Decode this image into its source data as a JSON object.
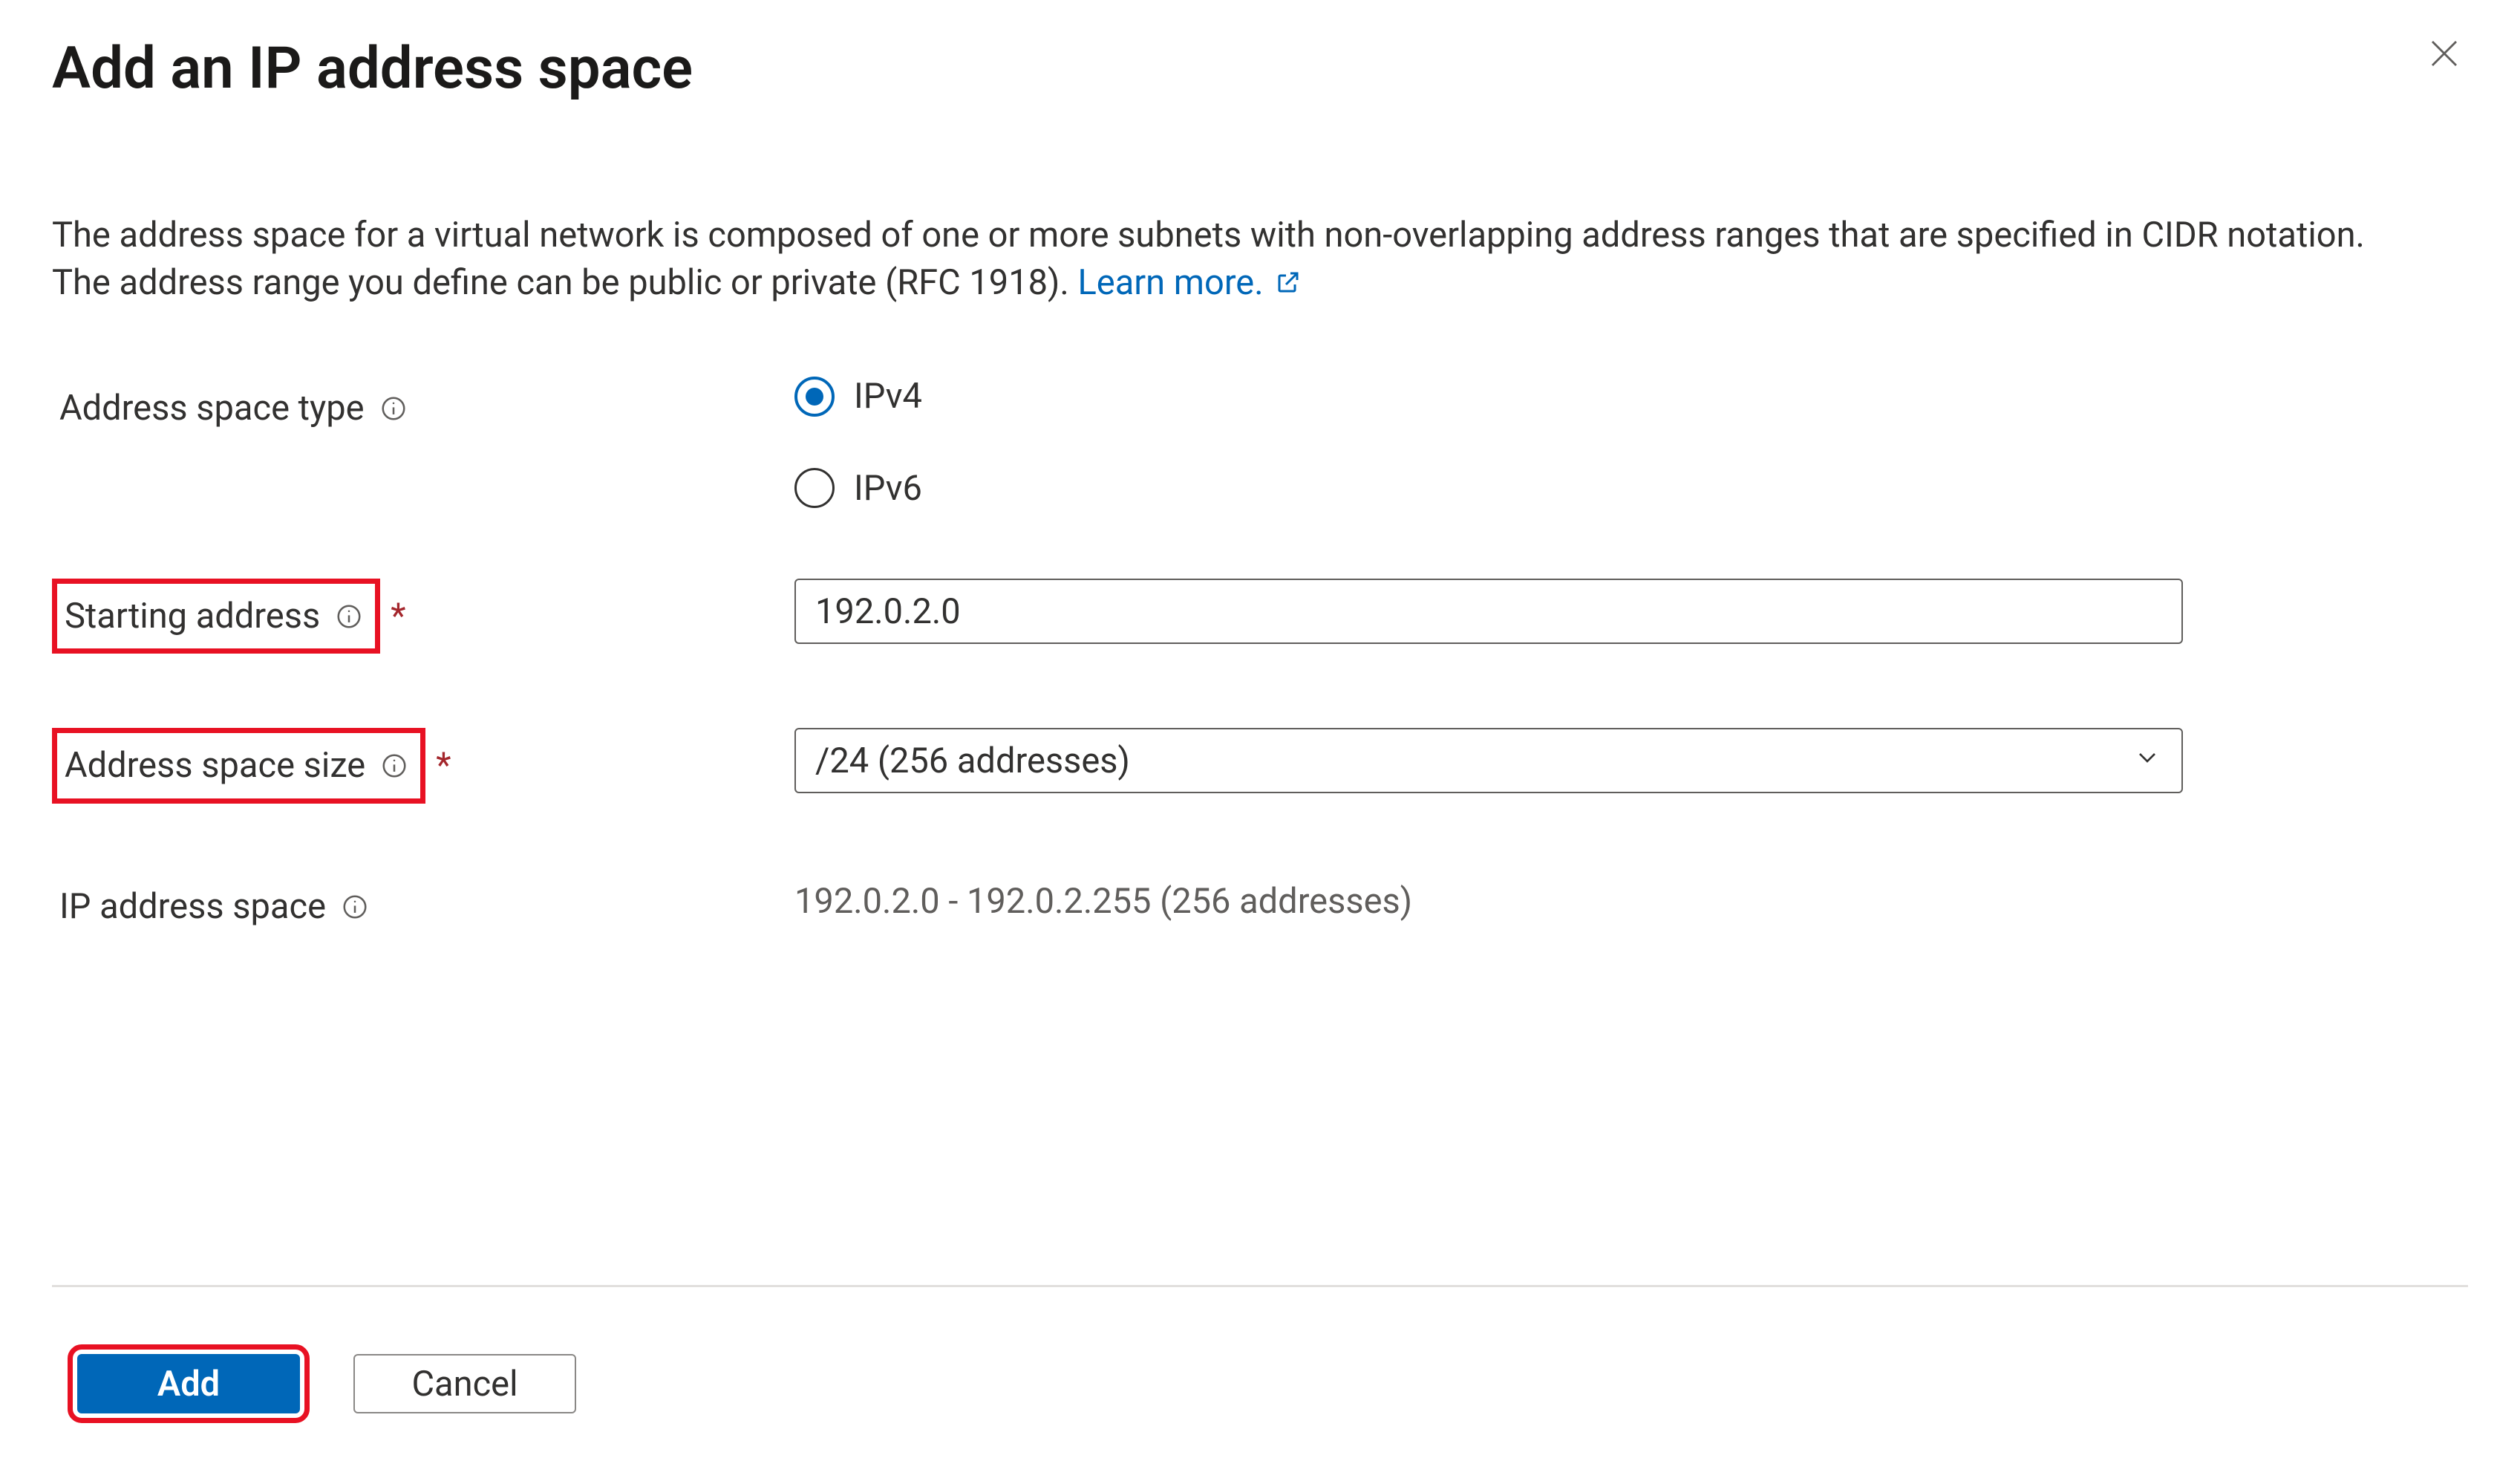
{
  "header": {
    "title": "Add an IP address space"
  },
  "description": {
    "text": "The address space for a virtual network is composed of one or more subnets with non-overlapping address ranges that are specified in CIDR notation. The address range you define can be public or private (RFC 1918). ",
    "learn_more_label": "Learn more."
  },
  "fields": {
    "address_space_type": {
      "label": "Address space type",
      "options": {
        "ipv4": "IPv4",
        "ipv6": "IPv6"
      },
      "selected": "ipv4"
    },
    "starting_address": {
      "label": "Starting address",
      "value": "192.0.2.0"
    },
    "address_space_size": {
      "label": "Address space size",
      "value": "/24 (256 addresses)"
    },
    "ip_address_space": {
      "label": "IP address space",
      "value": "192.0.2.0 - 192.0.2.255 (256 addresses)"
    }
  },
  "required_marker": "*",
  "footer": {
    "primary": "Add",
    "secondary": "Cancel"
  }
}
